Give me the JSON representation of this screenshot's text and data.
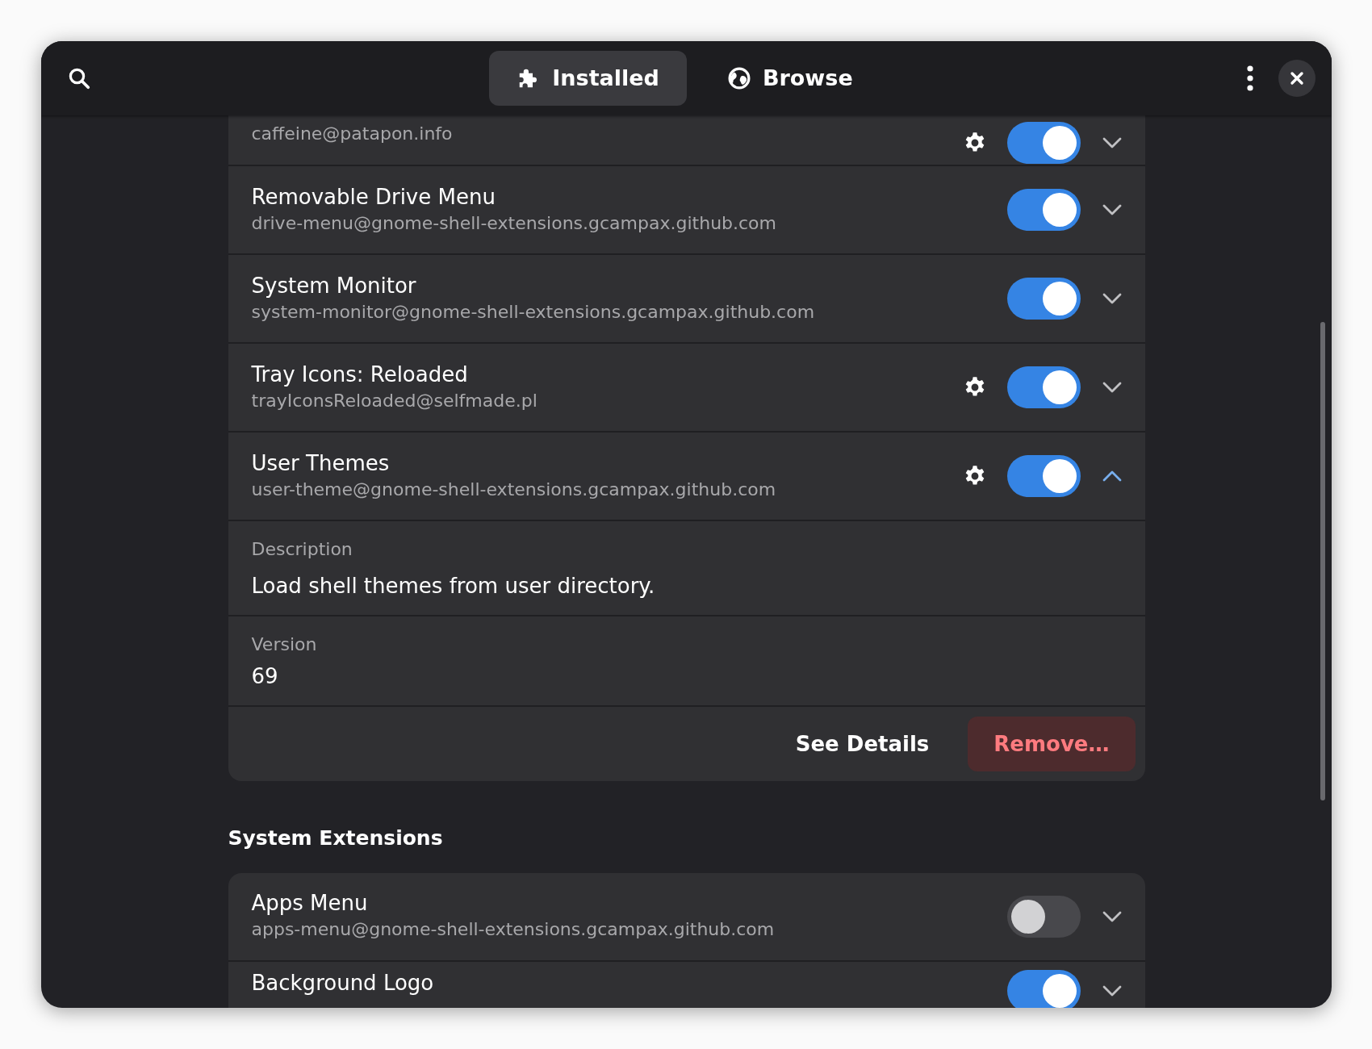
{
  "header": {
    "tabs": [
      {
        "label": "Installed",
        "selected": true
      },
      {
        "label": "Browse",
        "selected": false
      }
    ]
  },
  "user_extensions": [
    {
      "subtitle": "caffeine@patapon.info",
      "settings": true,
      "on": true,
      "expanded": false
    },
    {
      "title": "Removable Drive Menu",
      "subtitle": "drive-menu@gnome-shell-extensions.gcampax.github.com",
      "settings": false,
      "on": true,
      "expanded": false
    },
    {
      "title": "System Monitor",
      "subtitle": "system-monitor@gnome-shell-extensions.gcampax.github.com",
      "settings": false,
      "on": true,
      "expanded": false
    },
    {
      "title": "Tray Icons: Reloaded",
      "subtitle": "trayIconsReloaded@selfmade.pl",
      "settings": true,
      "on": true,
      "expanded": false
    },
    {
      "title": "User Themes",
      "subtitle": "user-theme@gnome-shell-extensions.gcampax.github.com",
      "settings": true,
      "on": true,
      "expanded": true,
      "details": {
        "description_label": "Description",
        "description": "Load shell themes from user directory.",
        "version_label": "Version",
        "version": "69",
        "see_details": "See Details",
        "remove": "Remove…"
      }
    }
  ],
  "system_section": {
    "title": "System Extensions",
    "extensions": [
      {
        "title": "Apps Menu",
        "subtitle": "apps-menu@gnome-shell-extensions.gcampax.github.com",
        "settings": false,
        "on": false,
        "expanded": false
      },
      {
        "title": "Background Logo",
        "settings": false,
        "on": true,
        "expanded": false
      }
    ]
  }
}
